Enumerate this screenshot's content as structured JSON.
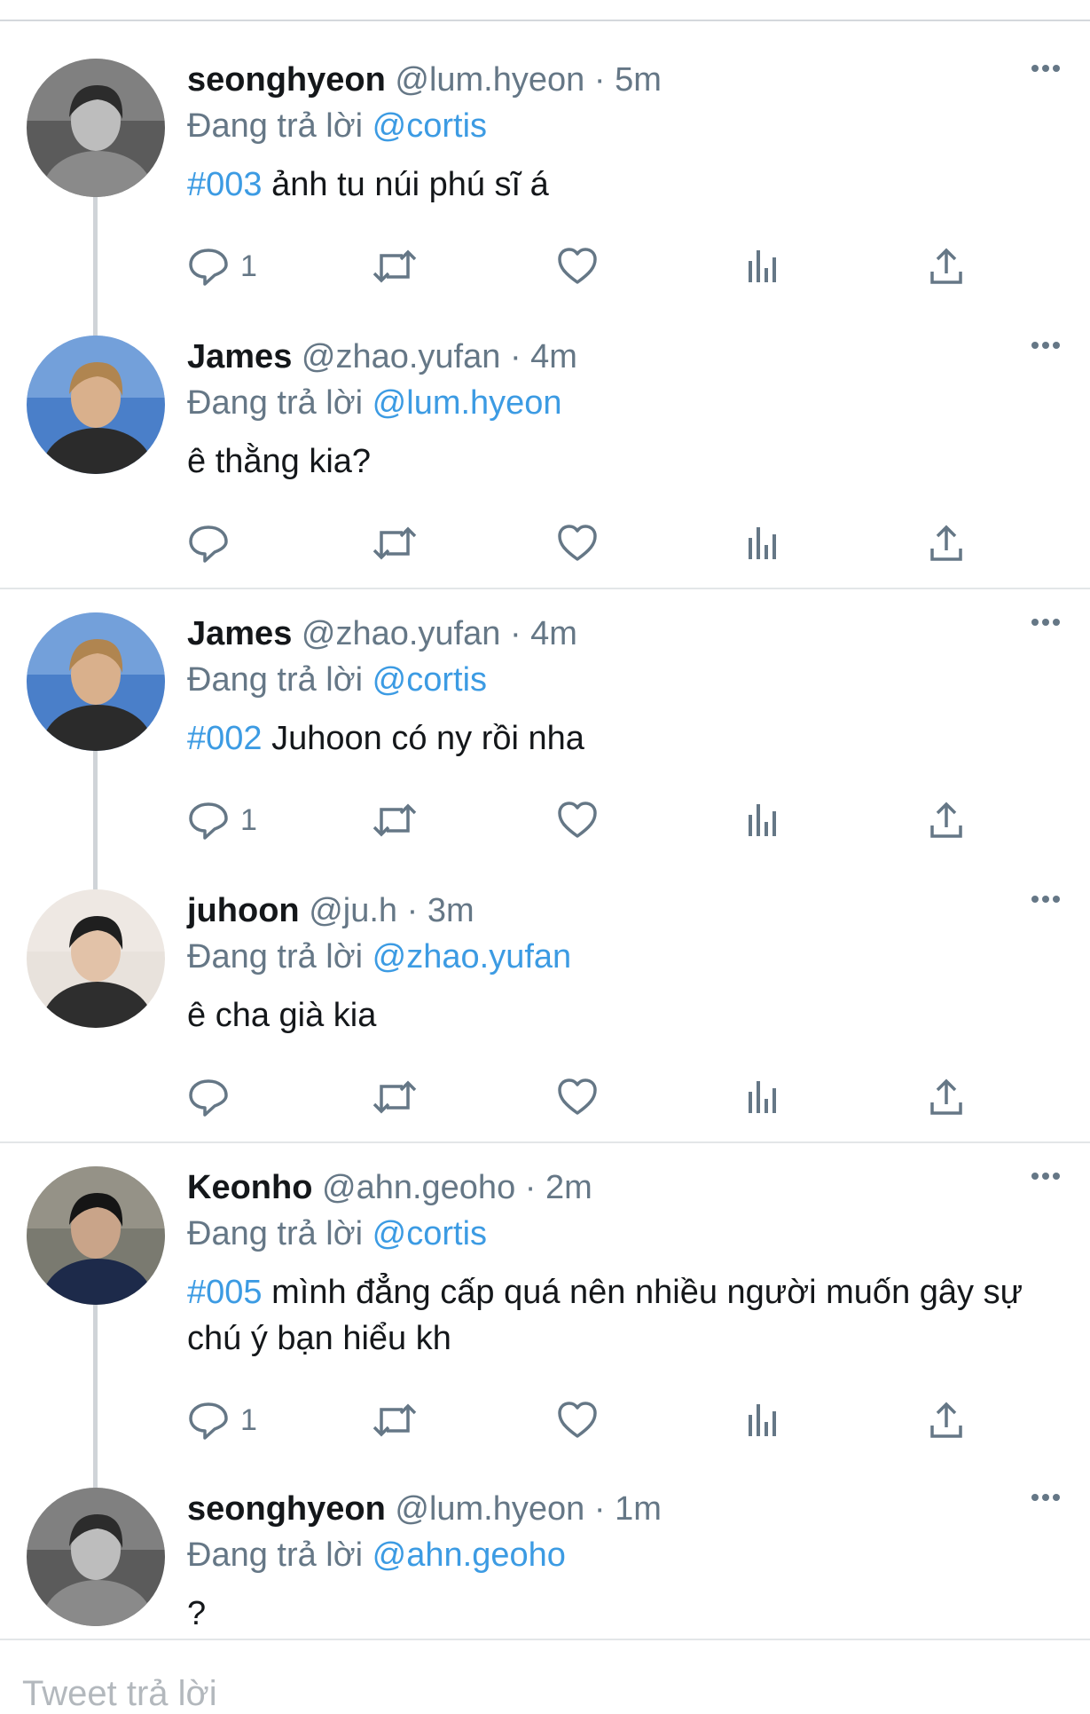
{
  "reply_prefix": "Đang trả lời",
  "compose_placeholder": "Tweet trả lời",
  "tweets": [
    {
      "name": "seonghyeon",
      "handle": "@lum.hyeon",
      "dot": "·",
      "time": "5m",
      "reply_to": "@cortis",
      "hashtag": "#003",
      "text": "ảnh tu núi phú sĩ á",
      "reply_count": "1"
    },
    {
      "name": "James",
      "handle": "@zhao.yufan",
      "dot": "·",
      "time": "4m",
      "reply_to": "@lum.hyeon",
      "hashtag": "",
      "text": "ê thằng kia?",
      "reply_count": ""
    },
    {
      "name": "James",
      "handle": "@zhao.yufan",
      "dot": "·",
      "time": "4m",
      "reply_to": "@cortis",
      "hashtag": "#002",
      "text": "Juhoon có ny rồi nha",
      "reply_count": "1"
    },
    {
      "name": "juhoon",
      "handle": "@ju.h",
      "dot": "·",
      "time": "3m",
      "reply_to": "@zhao.yufan",
      "hashtag": "",
      "text": "ê cha già kia",
      "reply_count": ""
    },
    {
      "name": "Keonho",
      "handle": "@ahn.geoho",
      "dot": "·",
      "time": "2m",
      "reply_to": "@cortis",
      "hashtag": "#005",
      "text": "mình đẳng cấp quá nên nhiều người muốn gây sự chú ý bạn hiểu kh",
      "reply_count": "1"
    },
    {
      "name": "seonghyeon",
      "handle": "@lum.hyeon",
      "dot": "·",
      "time": "1m",
      "reply_to": "@ahn.geoho",
      "hashtag": "",
      "text": "?",
      "reply_count": ""
    }
  ],
  "colors": {
    "link": "#3c9be3",
    "muted": "#657786",
    "text": "#14171a",
    "divider": "#e3e6e8"
  },
  "icons": [
    "reply-icon",
    "retweet-icon",
    "like-icon",
    "views-icon",
    "share-icon",
    "more-icon"
  ]
}
